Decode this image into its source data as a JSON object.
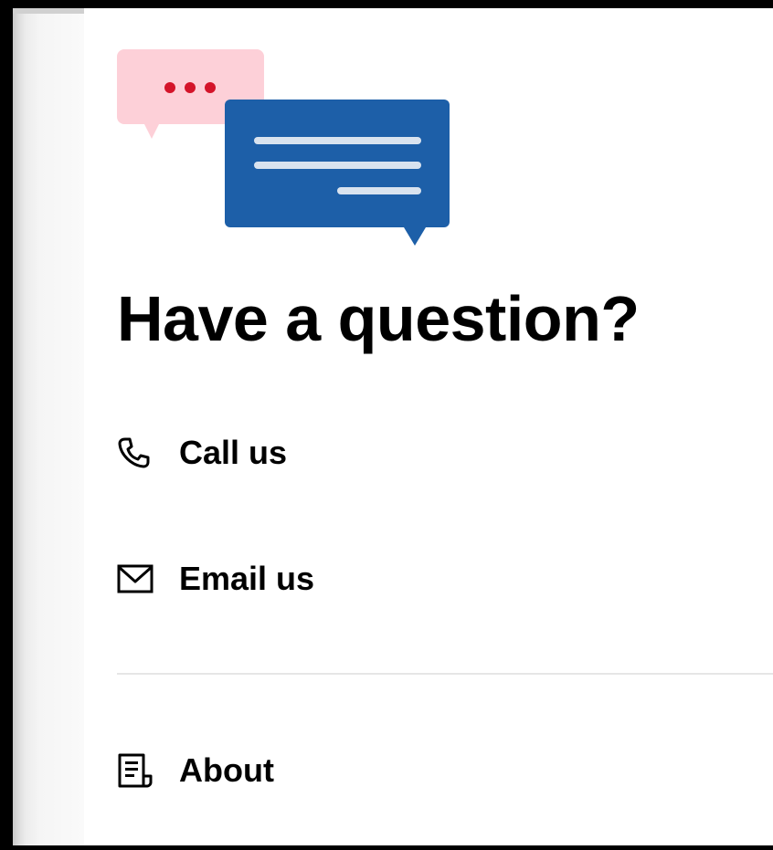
{
  "header": {
    "title": "Have a question?"
  },
  "contact": {
    "items": [
      {
        "label": "Call us",
        "icon": "phone-icon"
      },
      {
        "label": "Email us",
        "icon": "mail-icon"
      }
    ]
  },
  "footer": {
    "about_label": "About",
    "about_icon": "document-icon"
  },
  "illustration": {
    "icon": "chat-bubbles-illustration",
    "colors": {
      "pink_bubble": "#fdd0d8",
      "dots": "#d4142a",
      "blue_bubble": "#1d5fa8",
      "lines": "#d9e3ef"
    }
  },
  "colors": {
    "text": "#000000",
    "divider": "#e6e6e6",
    "background": "#ffffff"
  }
}
